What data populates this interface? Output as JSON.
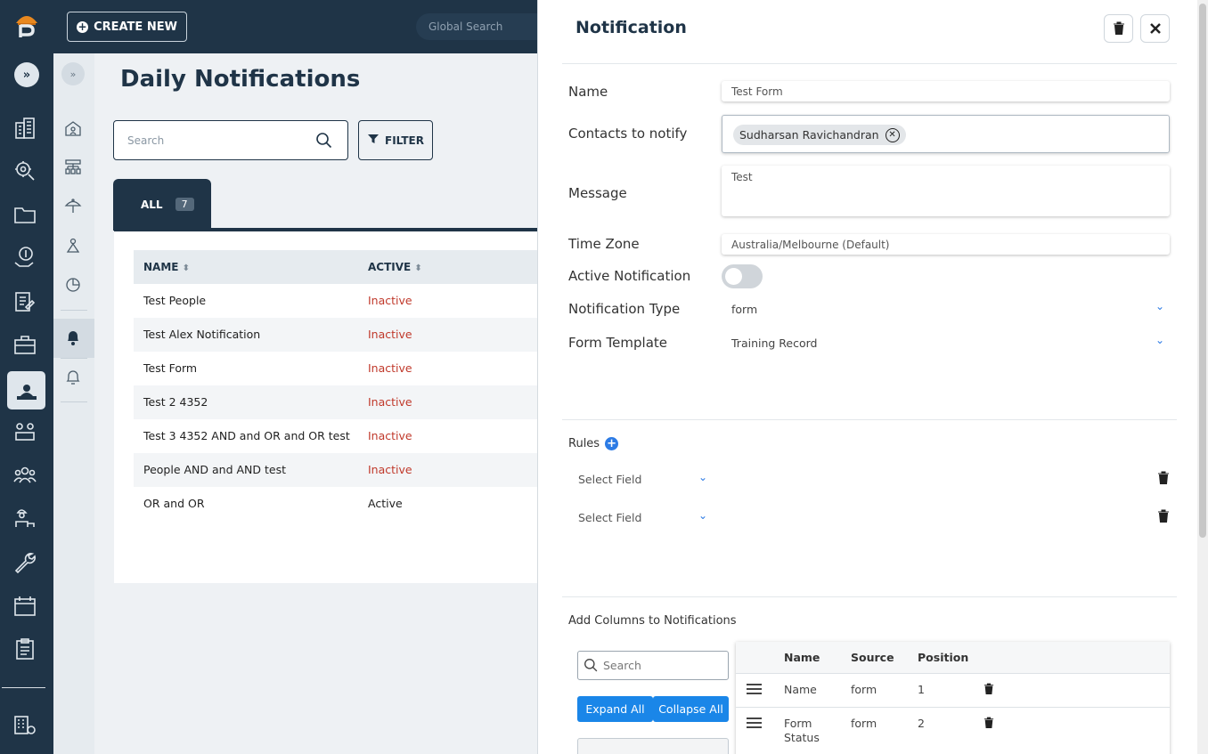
{
  "topbar": {
    "create_label": "CREATE NEW",
    "global_search_placeholder": "Global Search"
  },
  "rail": {
    "icons": [
      "buildings-icon",
      "gear-person-icon",
      "folder-icon",
      "money-hand-icon",
      "documents-icon",
      "briefcase-icon",
      "person-board-icon",
      "people-network-icon",
      "team-icon",
      "worker-icon",
      "wrench-icon",
      "calendar-icon",
      "clipboard-icon",
      "building-settings-icon"
    ],
    "active": "person-board-icon"
  },
  "subnav": {
    "icons": [
      "house-user-icon",
      "org-chart-icon",
      "umbrella-person-icon",
      "person-lift-icon",
      "pie-chart-icon",
      "bell-person-icon",
      "bell-icon"
    ],
    "active": "bell-person-icon"
  },
  "main": {
    "title": "Daily Notifications",
    "search_placeholder": "Search",
    "filter_label": "FILTER",
    "tab_label": "ALL",
    "tab_count": "7",
    "columns": [
      "NAME",
      "ACTIVE"
    ],
    "rows": [
      {
        "name": "Test People",
        "active": "Inactive"
      },
      {
        "name": "Test Alex Notification",
        "active": "Inactive"
      },
      {
        "name": "Test Form",
        "active": "Inactive"
      },
      {
        "name": "Test 2 4352",
        "active": "Inactive"
      },
      {
        "name": "Test 3 4352 AND and OR and OR test",
        "active": "Inactive"
      },
      {
        "name": "People AND and AND test",
        "active": "Inactive"
      },
      {
        "name": "OR and OR",
        "active": "Active"
      }
    ]
  },
  "panel": {
    "title": "Notification",
    "name_label": "Name",
    "name_value": "Test Form",
    "contacts_label": "Contacts to notify",
    "contact_chip": "Sudharsan Ravichandran",
    "message_label": "Message",
    "message_value": "Test",
    "timezone_label": "Time Zone",
    "timezone_value": "Australia/Melbourne (Default)",
    "active_label": "Active Notification",
    "active_on": false,
    "type_label": "Notification Type",
    "type_value": "form",
    "template_label": "Form Template",
    "template_value": "Training Record",
    "rules_label": "Rules",
    "rule_selects": [
      "Select Field",
      "Select Field"
    ],
    "columns_label": "Add Columns to Notifications",
    "columns_search_placeholder": "Search",
    "expand_all": "Expand All",
    "collapse_all": "Collapse All",
    "columns_table": {
      "headers": [
        "Name",
        "Source",
        "Position"
      ],
      "rows": [
        {
          "name": "Name",
          "source": "form",
          "position": "1"
        },
        {
          "name": "Form Status",
          "source": "form",
          "position": "2"
        }
      ]
    }
  },
  "colors": {
    "navy": "#1f3447",
    "inactive_red": "#c0392b",
    "accent_blue": "#1a86e8"
  }
}
